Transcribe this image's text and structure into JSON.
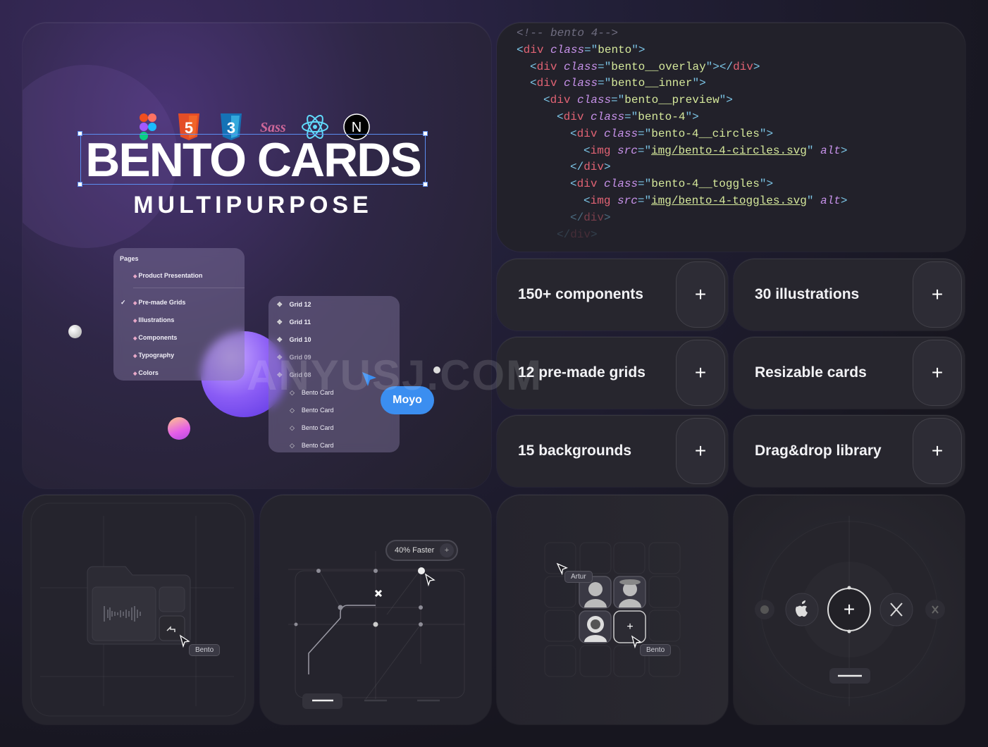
{
  "hero": {
    "tech_icons": [
      "figma-icon",
      "html5-icon",
      "css3-icon",
      "sass-icon",
      "react-icon",
      "nextjs-icon"
    ],
    "title": "BENTO CARDS",
    "subtitle": "MULTIPURPOSE",
    "pages_panel": {
      "heading": "Pages",
      "items": [
        {
          "label": "Product Presentation",
          "icon": "pencil-icon"
        },
        {
          "label": "Pre-made Grids",
          "icon": "square-icon",
          "checked": true
        },
        {
          "label": "Illustrations",
          "icon": "brain-icon"
        },
        {
          "label": "Components",
          "icon": "contrast-icon"
        },
        {
          "label": "Typography",
          "icon": "pen-icon"
        },
        {
          "label": "Colors",
          "icon": "brain-icon"
        }
      ]
    },
    "grid_panel": {
      "items": [
        {
          "label": "Grid 12",
          "icon": "component-icon"
        },
        {
          "label": "Grid 11",
          "icon": "component-icon"
        },
        {
          "label": "Grid 10",
          "icon": "component-icon"
        },
        {
          "label": "Grid 09",
          "icon": "component-icon"
        },
        {
          "label": "Grid 08",
          "icon": "component-icon"
        },
        {
          "label": "Bento Card",
          "icon": "diamond-icon"
        },
        {
          "label": "Bento Card",
          "icon": "diamond-icon"
        },
        {
          "label": "Bento Card",
          "icon": "diamond-icon"
        },
        {
          "label": "Bento Card",
          "icon": "diamond-icon"
        }
      ]
    },
    "cursor_label": "Moyo",
    "accent": "#3b8ef0"
  },
  "code": {
    "lines": [
      {
        "indent": 0,
        "tokens": [
          [
            "<!-- bento 4-->",
            "c"
          ]
        ]
      },
      {
        "indent": 0,
        "tokens": [
          [
            "<",
            "p"
          ],
          [
            "div",
            "n"
          ],
          [
            " ",
            "p"
          ],
          [
            "class",
            "a"
          ],
          [
            "=\"",
            "p"
          ],
          [
            "bento",
            "s"
          ],
          [
            "\">",
            "p"
          ]
        ]
      },
      {
        "indent": 1,
        "tokens": [
          [
            "<",
            "p"
          ],
          [
            "div",
            "n"
          ],
          [
            " ",
            "p"
          ],
          [
            "class",
            "a"
          ],
          [
            "=\"",
            "p"
          ],
          [
            "bento__overlay",
            "s"
          ],
          [
            "\"></",
            "p"
          ],
          [
            "div",
            "n"
          ],
          [
            ">",
            "p"
          ]
        ]
      },
      {
        "indent": 1,
        "tokens": [
          [
            "<",
            "p"
          ],
          [
            "div",
            "n"
          ],
          [
            " ",
            "p"
          ],
          [
            "class",
            "a"
          ],
          [
            "=\"",
            "p"
          ],
          [
            "bento__inner",
            "s"
          ],
          [
            "\">",
            "p"
          ]
        ]
      },
      {
        "indent": 2,
        "tokens": [
          [
            "<",
            "p"
          ],
          [
            "div",
            "n"
          ],
          [
            " ",
            "p"
          ],
          [
            "class",
            "a"
          ],
          [
            "=\"",
            "p"
          ],
          [
            "bento__preview",
            "s"
          ],
          [
            "\">",
            "p"
          ]
        ]
      },
      {
        "indent": 3,
        "tokens": [
          [
            "<",
            "p"
          ],
          [
            "div",
            "n"
          ],
          [
            " ",
            "p"
          ],
          [
            "class",
            "a"
          ],
          [
            "=\"",
            "p"
          ],
          [
            "bento-4",
            "s"
          ],
          [
            "\">",
            "p"
          ]
        ]
      },
      {
        "indent": 4,
        "tokens": [
          [
            "<",
            "p"
          ],
          [
            "div",
            "n"
          ],
          [
            " ",
            "p"
          ],
          [
            "class",
            "a"
          ],
          [
            "=\"",
            "p"
          ],
          [
            "bento-4__circles",
            "s"
          ],
          [
            "\">",
            "p"
          ]
        ]
      },
      {
        "indent": 5,
        "tokens": [
          [
            "<",
            "p"
          ],
          [
            "img",
            "n"
          ],
          [
            " ",
            "p"
          ],
          [
            "src",
            "a"
          ],
          [
            "=\"",
            "p"
          ],
          [
            "img/bento-4-circles.svg",
            "u"
          ],
          [
            "\" ",
            "p"
          ],
          [
            "alt",
            "a"
          ],
          [
            ">",
            "p"
          ]
        ]
      },
      {
        "indent": 4,
        "tokens": [
          [
            "</",
            "p"
          ],
          [
            "div",
            "n"
          ],
          [
            ">",
            "p"
          ]
        ]
      },
      {
        "indent": 4,
        "tokens": [
          [
            "<",
            "p"
          ],
          [
            "div",
            "n"
          ],
          [
            " ",
            "p"
          ],
          [
            "class",
            "a"
          ],
          [
            "=\"",
            "p"
          ],
          [
            "bento-4__toggles",
            "s"
          ],
          [
            "\">",
            "p"
          ]
        ]
      },
      {
        "indent": 5,
        "tokens": [
          [
            "<",
            "p"
          ],
          [
            "img",
            "n"
          ],
          [
            " ",
            "p"
          ],
          [
            "src",
            "a"
          ],
          [
            "=\"",
            "p"
          ],
          [
            "img/bento-4-toggles.svg",
            "u"
          ],
          [
            "\" ",
            "p"
          ],
          [
            "alt",
            "a"
          ],
          [
            ">",
            "p"
          ]
        ]
      },
      {
        "indent": 4,
        "tokens": [
          [
            "</",
            "p"
          ],
          [
            "div",
            "n"
          ],
          [
            ">",
            "p"
          ]
        ]
      },
      {
        "indent": 3,
        "tokens": [
          [
            "</",
            "p"
          ],
          [
            "div",
            "n"
          ],
          [
            ">",
            "p"
          ]
        ]
      }
    ]
  },
  "features": [
    {
      "label": "150+ components",
      "button": "+"
    },
    {
      "label": "30 illustrations",
      "button": "+"
    },
    {
      "label": "12 pre-made grids",
      "button": "+"
    },
    {
      "label": "Resizable cards",
      "button": "+"
    },
    {
      "label": "15 backgrounds",
      "button": "+"
    },
    {
      "label": "Drag&drop library",
      "button": "+"
    }
  ],
  "tiles": {
    "folder": {
      "cursor_tag": "Bento",
      "icon": "share-icon"
    },
    "path": {
      "pill": "40% Faster",
      "pill_button": "+"
    },
    "avatars": {
      "cursor_tag_top": "Artur",
      "cursor_tag_bottom": "Bento",
      "add_button": "+"
    },
    "social": {
      "icons": [
        "messenger-icon",
        "apple-icon",
        "plus-icon",
        "x-icon",
        "plugin-icon"
      ],
      "center_button": "+"
    }
  },
  "watermark": "ANYUSJ.COM"
}
